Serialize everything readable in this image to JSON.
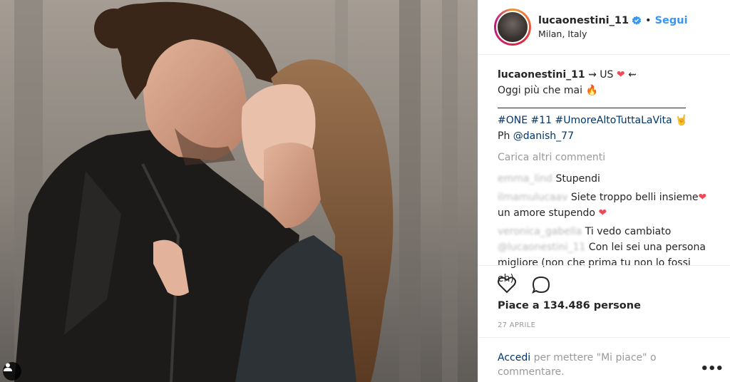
{
  "post": {
    "username": "lucaonestini_11",
    "follow_label": "Segui",
    "dot": "•",
    "location": "Milan, Italy"
  },
  "caption": {
    "author": "lucaonestini_11",
    "line1_text": " ⇝ US ",
    "line1_end": " ⇜",
    "line2": "Oggi più che mai",
    "hashtags": "#ONE #11 #UmoreAltoTuttaLaVita",
    "photo_prefix": "Ph ",
    "photo_credit": "@danish_77"
  },
  "load_more": "Carica altri commenti",
  "comments": [
    {
      "user": "emma_lind",
      "text": "Stupendi"
    },
    {
      "user": "ilmamulucaav",
      "text": "Siete troppo belli insieme",
      "text2": "un amore stupendo"
    },
    {
      "user": "veronica_gabella",
      "mention": "@lucaonestini_11",
      "text": "Ti vedo cambiato",
      "text2": "Con lei sei una persona migliore (non che prima tu non lo fossi eh)."
    }
  ],
  "likes_text": "Piace a 134.486 persone",
  "date": "27 APRILE",
  "login": {
    "link": "Accedi",
    "rest": " per mettere \"Mi piace\" o commentare."
  },
  "more_options": "•••",
  "icons": {
    "like": "heart-outline-icon",
    "comment": "comment-bubble-icon",
    "verified": "verified-badge-icon",
    "user_tag": "user-tag-icon"
  },
  "colors": {
    "accent": "#3897f0",
    "link": "#003569",
    "muted": "#999999",
    "heart": "#ed4956"
  }
}
